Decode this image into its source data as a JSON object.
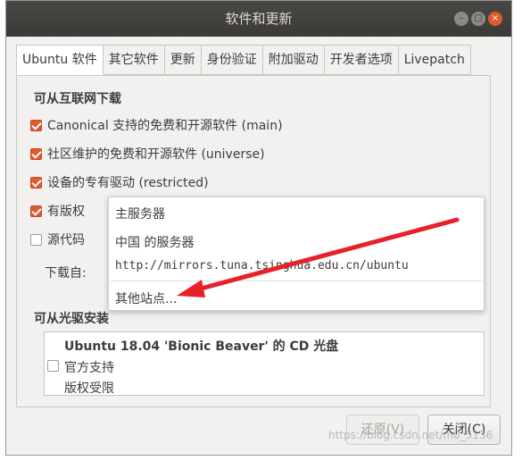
{
  "window": {
    "title": "软件和更新"
  },
  "tabs": [
    {
      "label": "Ubuntu 软件",
      "active": true
    },
    {
      "label": "其它软件",
      "active": false
    },
    {
      "label": "更新",
      "active": false
    },
    {
      "label": "身份验证",
      "active": false
    },
    {
      "label": "附加驱动",
      "active": false
    },
    {
      "label": "开发者选项",
      "active": false
    },
    {
      "label": "Livepatch",
      "active": false
    }
  ],
  "internet": {
    "heading": "可从互联网下载",
    "options": [
      {
        "label": "Canonical 支持的免费和开源软件 (main)",
        "checked": true
      },
      {
        "label": "社区维护的免费和开源软件 (universe)",
        "checked": true
      },
      {
        "label": "设备的专有驱动 (restricted)",
        "checked": true
      },
      {
        "label": "有版权",
        "checked": true
      },
      {
        "label": "源代码",
        "checked": false
      }
    ],
    "download_from_label": "下载自:"
  },
  "server_menu": {
    "items": [
      "主服务器",
      "中国 的服务器",
      "http://mirrors.tuna.tsinghua.edu.cn/ubuntu",
      "其他站点..."
    ]
  },
  "cdrom": {
    "heading": "可从光驱安装",
    "disc_title": "Ubuntu 18.04 'Bionic Beaver' 的 CD 光盘",
    "lines": [
      "官方支持",
      "版权受限"
    ],
    "checked": false
  },
  "buttons": {
    "revert": "还原(V)",
    "close": "关闭(C)"
  },
  "watermark": "https://blog.csdn.net/m0_5136",
  "colors": {
    "accent": "#e05a2b",
    "titlebar": "#3b3a37",
    "arrow": "#e8202a"
  }
}
